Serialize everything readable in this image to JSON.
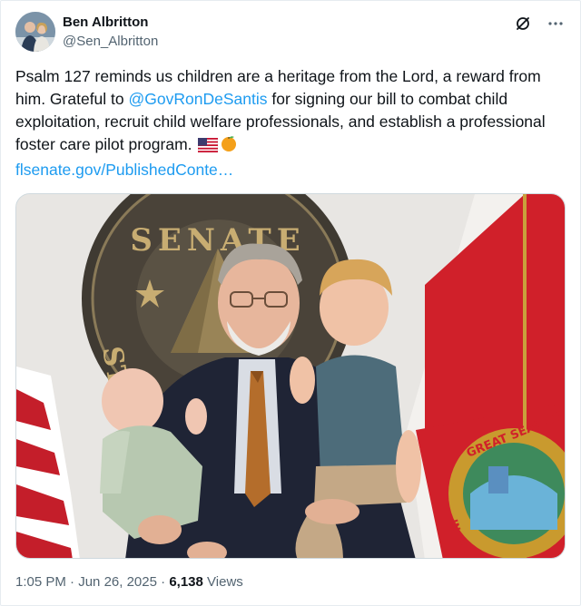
{
  "author": {
    "display_name": "Ben Albritton",
    "handle": "@Sen_Albritton",
    "avatar_icon": "user-avatar"
  },
  "tweet": {
    "text_part1": "Psalm 127 reminds us children are a heritage from the Lord, a reward from him. Grateful to ",
    "mention": "@GovRonDeSantis",
    "text_part2": " for signing our bill to combat child exploitation, recruit child welfare professionals, and establish a professional foster care pilot program. ",
    "link": "flsenate.gov/PublishedConte…"
  },
  "media": {
    "seal_text": "SENATE",
    "seal_side_left": "STA",
    "florida_seal_text": "GREAT SEAL OF THE",
    "florida_seal_text_2": "IN GOD WE"
  },
  "footer": {
    "time": "1:05 PM",
    "separator": "·",
    "date": "Jun 26, 2025",
    "separator2": "·",
    "views_count": "6,138",
    "views_label": "Views"
  },
  "colors": {
    "accent": "#1d9bf0",
    "secondary_text": "#536471",
    "primary_text": "#0f1419"
  }
}
